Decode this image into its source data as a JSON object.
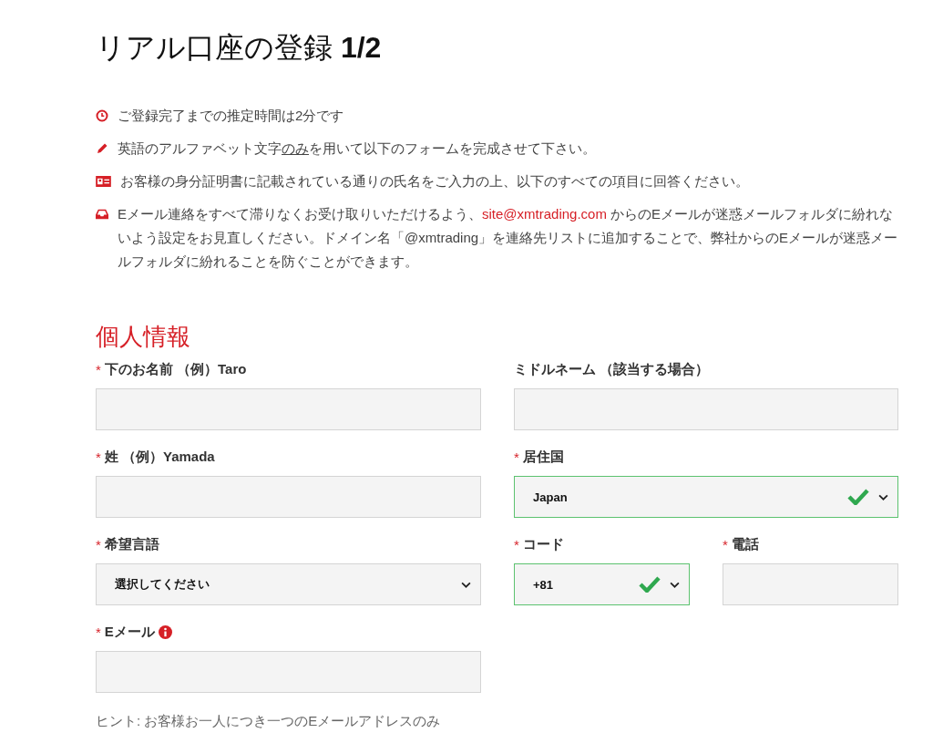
{
  "title": "リアル口座の登録 **1/2**",
  "notices": [
    {
      "parts": [
        {
          "kind": "plain",
          "text": "ご登録完了までの推定時間は2分です"
        }
      ]
    },
    {
      "parts": [
        {
          "kind": "plain",
          "text": "英語のアルファベット文字"
        },
        {
          "kind": "underline",
          "text": "のみ"
        },
        {
          "kind": "plain",
          "text": "を用いて以下のフォームを完成させて下さい。"
        }
      ]
    },
    {
      "parts": [
        {
          "kind": "plain",
          "text": "お客様の身分証明書に記載されている通りの氏名をご入力の上、以下のすべての項目に回答ください。"
        }
      ]
    },
    {
      "parts": [
        {
          "kind": "plain",
          "text": "Eメール連絡をすべて滞りなくお受け取りいただけるよう、"
        },
        {
          "kind": "link",
          "text": "site@xmtrading.com"
        },
        {
          "kind": "plain",
          "text": " からのEメールが迷惑メールフォルダに紛れないよう設定をお見直しください。ドメイン名「@xmtrading」を連絡先リストに追加することで、弊社からのEメールが迷惑メールフォルダに紛れることを防ぐことができます。"
        }
      ]
    }
  ],
  "section_title": "個人情報",
  "rows": [
    {
      "left": [
        {
          "label": "下のお名前 （例）Taro",
          "marker": "*",
          "kind": "text"
        }
      ],
      "right": [
        {
          "label": "ミドルネーム （該当する場合）",
          "kind": "text"
        }
      ]
    },
    {
      "left": [
        {
          "label": "姓 （例）Yamada",
          "marker": "*",
          "kind": "text"
        }
      ],
      "right": [
        {
          "label": "居住国",
          "marker": "*",
          "kind": "select",
          "value": "Japan",
          "valid": true
        }
      ]
    },
    {
      "left": [
        {
          "label": "希望言語",
          "marker": "*",
          "kind": "select",
          "value": "選択してください",
          "valid": false
        }
      ],
      "right": [
        {
          "label": "コード",
          "marker": "*",
          "kind": "select",
          "value": "+81",
          "valid": true
        },
        {
          "label": "電話",
          "marker": "*",
          "kind": "text"
        }
      ]
    },
    {
      "left": [
        {
          "label": "Eメール",
          "marker": "*",
          "kind": "text",
          "info": true
        }
      ],
      "right": []
    }
  ],
  "hint": "ヒント: お客様お一人につき一つのEメールアドレスのみ"
}
